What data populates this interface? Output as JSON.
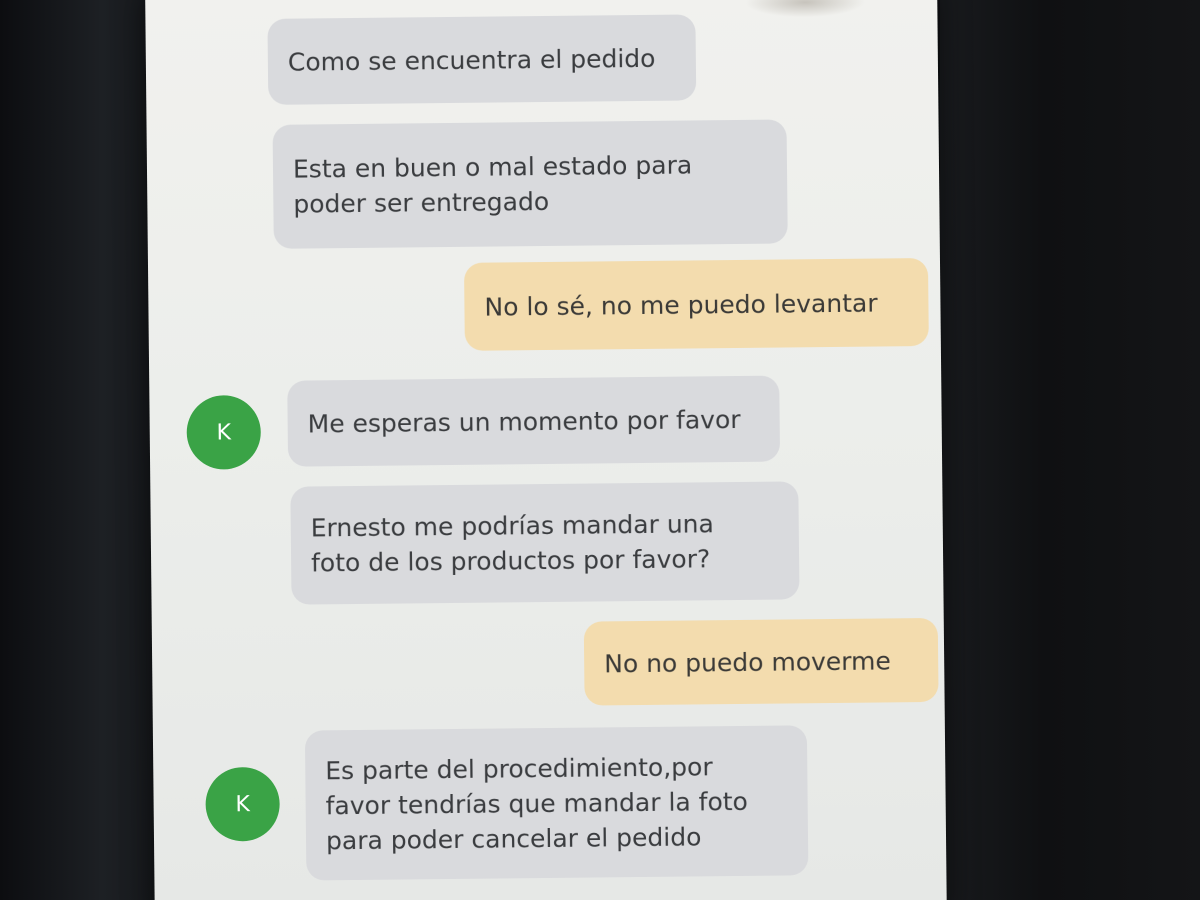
{
  "avatar_letter": "K",
  "colors": {
    "incoming_bubble": "#d9dadd",
    "outgoing_bubble": "#f3dcae",
    "avatar": "#3aa346"
  },
  "messages": [
    {
      "sender": "agent",
      "text": "Como se encuentra el pedido"
    },
    {
      "sender": "agent",
      "text": "Esta en buen o mal estado para\npoder ser entregado"
    },
    {
      "sender": "user",
      "text": "No lo sé, no me puedo levantar"
    },
    {
      "sender": "agent",
      "text": "Me esperas un momento por favor"
    },
    {
      "sender": "agent",
      "text": "Ernesto me podrías mandar una\nfoto de los productos por favor?"
    },
    {
      "sender": "user",
      "text": "No no puedo moverme"
    },
    {
      "sender": "agent",
      "text": "Es parte del procedimiento,por\nfavor tendrías que mandar la foto\npara poder cancelar el pedido"
    }
  ]
}
